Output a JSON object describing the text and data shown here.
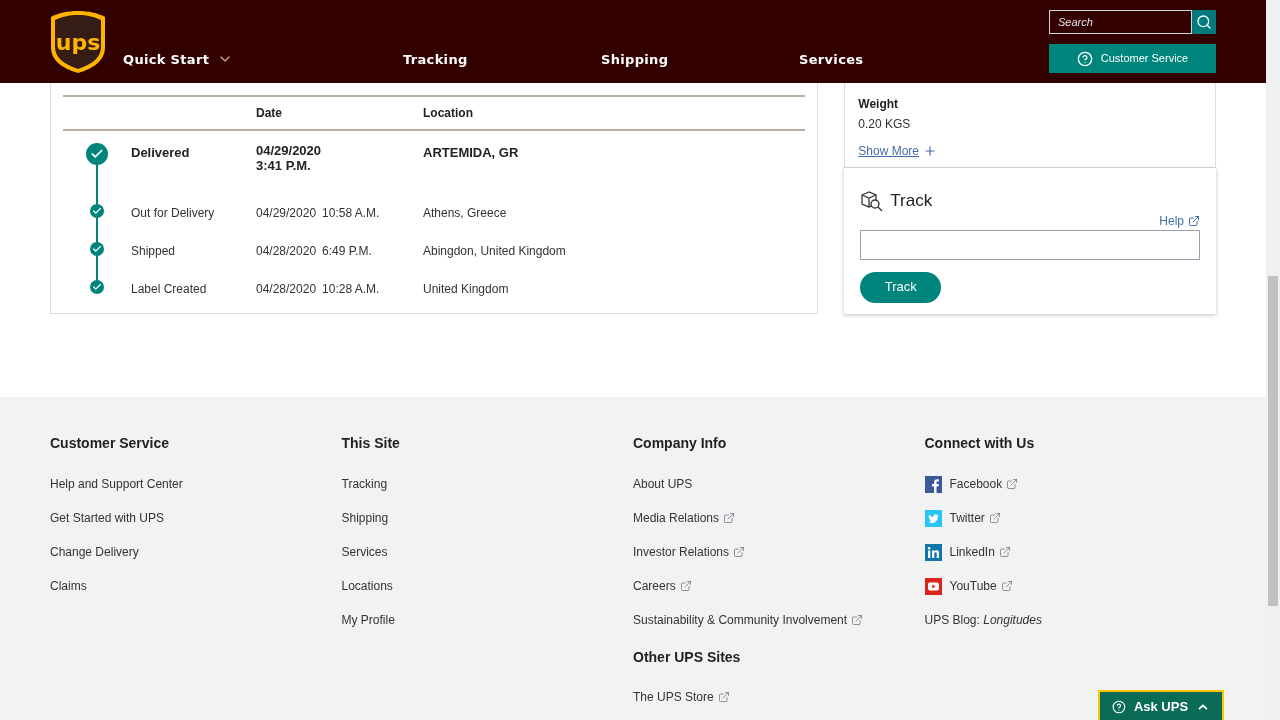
{
  "header": {
    "logo": "ups",
    "nav": [
      {
        "label": "Quick Start",
        "dropdown": true
      },
      {
        "label": "Tracking",
        "dropdown": false
      },
      {
        "label": "Shipping",
        "dropdown": false
      },
      {
        "label": "Services",
        "dropdown": false
      }
    ],
    "search": {
      "placeholder": "Search"
    },
    "customer_service": "Customer Service"
  },
  "progress": {
    "columns": [
      "Date",
      "Location"
    ],
    "events": [
      {
        "status": "Delivered",
        "date": "04/29/2020",
        "time": "3:41 P.M.",
        "location": "ARTEMIDA, GR",
        "kind": "latest"
      },
      {
        "status": "Out for Delivery",
        "date": "04/29/2020",
        "time": "10:58 A.M.",
        "location": "Athens, Greece",
        "kind": "past"
      },
      {
        "status": "Shipped",
        "date": "04/28/2020",
        "time": "6:49 P.M.",
        "location": "Abingdon, United Kingdom",
        "kind": "past"
      },
      {
        "status": "Label Created",
        "date": "04/28/2020",
        "time": "10:28 A.M.",
        "location": "United Kingdom",
        "kind": "past"
      }
    ]
  },
  "details": {
    "label": "Weight",
    "value": "0.20 KGS",
    "show_more": "Show More"
  },
  "track": {
    "title": "Track",
    "help": "Help",
    "button": "Track"
  },
  "footer": {
    "columns": [
      {
        "heading": "Customer Service",
        "links": [
          {
            "label": "Help and Support Center",
            "external": false
          },
          {
            "label": "Get Started with UPS",
            "external": false
          },
          {
            "label": "Change Delivery",
            "external": false
          },
          {
            "label": "Claims",
            "external": false
          }
        ]
      },
      {
        "heading": "This Site",
        "links": [
          {
            "label": "Tracking",
            "external": false
          },
          {
            "label": "Shipping",
            "external": false
          },
          {
            "label": "Services",
            "external": false
          },
          {
            "label": "Locations",
            "external": false
          },
          {
            "label": "My Profile",
            "external": false
          }
        ]
      },
      {
        "heading": "Company Info",
        "links": [
          {
            "label": "About UPS",
            "external": false
          },
          {
            "label": "Media Relations",
            "external": true
          },
          {
            "label": "Investor Relations",
            "external": true
          },
          {
            "label": "Careers",
            "external": true
          },
          {
            "label": "Sustainability & Community Involvement",
            "external": true
          }
        ],
        "subheading": "Other UPS Sites",
        "sublinks": [
          {
            "label": "The UPS Store",
            "external": true
          }
        ]
      },
      {
        "heading": "Connect with Us",
        "links": [
          {
            "label": "Facebook",
            "external": true,
            "kind": "facebook"
          },
          {
            "label": "Twitter",
            "external": true,
            "kind": "twitter"
          },
          {
            "label": "LinkedIn",
            "external": true,
            "kind": "linkedin"
          },
          {
            "label": "YouTube",
            "external": true,
            "kind": "youtube"
          },
          {
            "label": "UPS Blog: *Longitudes*",
            "external": false,
            "kind": "text"
          }
        ]
      }
    ]
  },
  "ask": {
    "label": "Ask UPS"
  }
}
